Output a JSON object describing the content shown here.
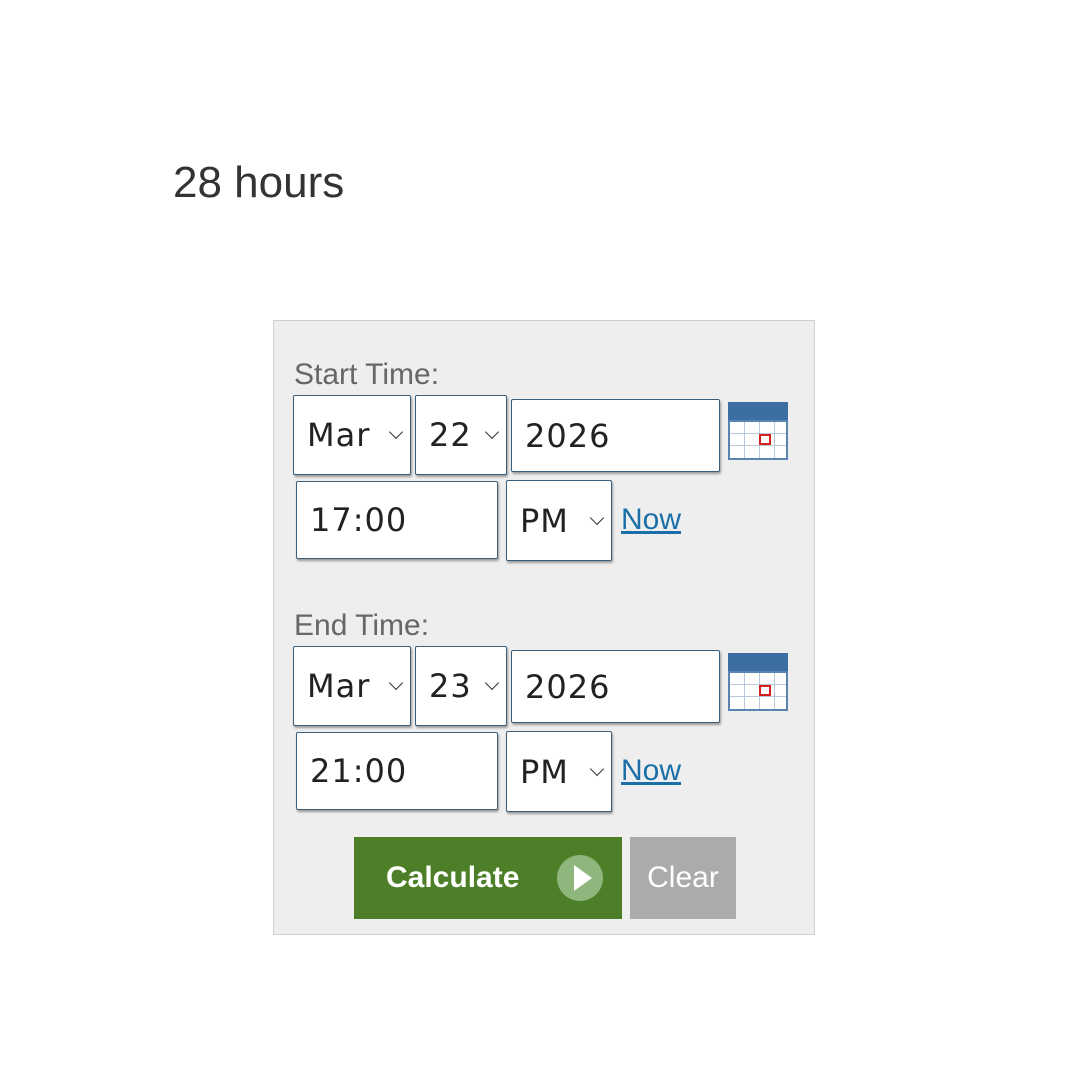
{
  "result": {
    "text": "28 hours"
  },
  "start": {
    "label": "Start Time:",
    "month": "Mar",
    "day": "22",
    "year": "2026",
    "time": "17:00",
    "ampm": "PM",
    "now_link": "Now"
  },
  "end": {
    "label": "End Time:",
    "month": "Mar",
    "day": "23",
    "year": "2026",
    "time": "21:00",
    "ampm": "PM",
    "now_link": "Now"
  },
  "buttons": {
    "calculate": "Calculate",
    "clear": "Clear"
  },
  "colors": {
    "calculate_bg": "#4c7f27",
    "clear_bg": "#ababab",
    "link": "#1a6fa8",
    "panel_bg": "#eeeeee"
  },
  "icons": {
    "calendar": "calendar-icon",
    "dropdown": "chevron-down-icon",
    "play": "play-icon"
  }
}
